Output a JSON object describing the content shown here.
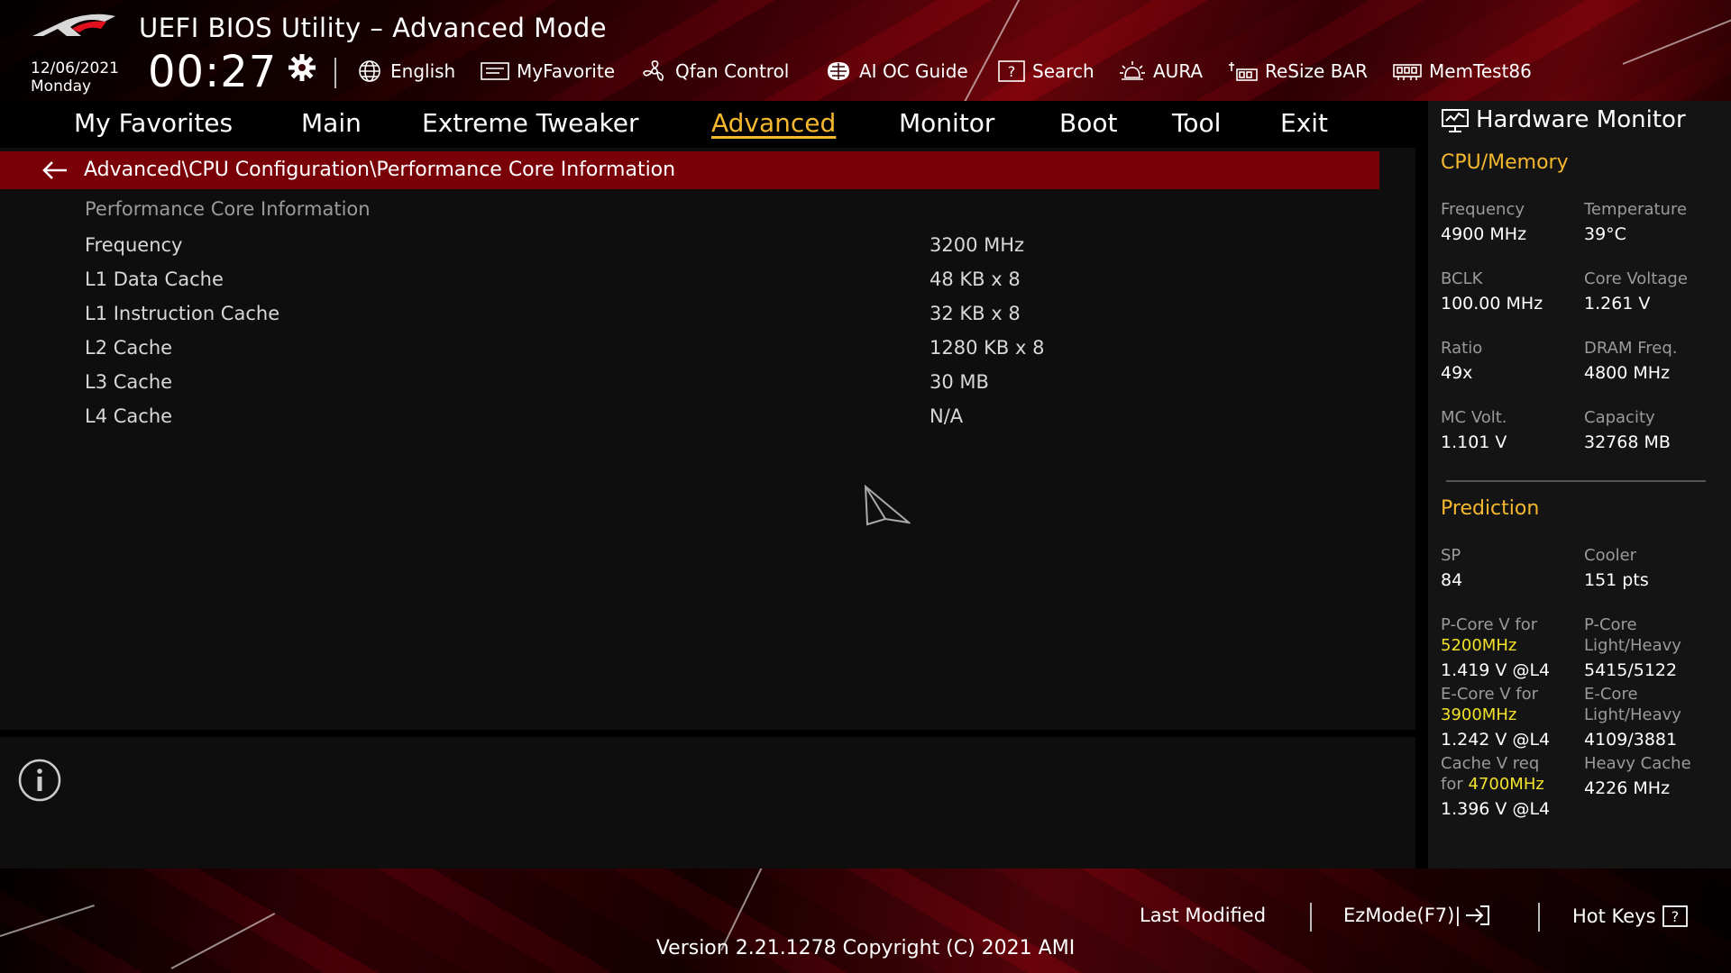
{
  "app": {
    "title": "UEFI BIOS Utility – Advanced Mode",
    "date": "12/06/2021",
    "day": "Monday",
    "time": "00:27"
  },
  "toolbar": [
    {
      "label": "English",
      "icon": "globe-icon"
    },
    {
      "label": "MyFavorite",
      "icon": "favorite-icon"
    },
    {
      "label": "Qfan Control",
      "icon": "fan-icon"
    },
    {
      "label": "AI OC Guide",
      "icon": "ai-oc-icon"
    },
    {
      "label": "Search",
      "icon": "search-icon"
    },
    {
      "label": "AURA",
      "icon": "aura-icon"
    },
    {
      "label": "ReSize BAR",
      "icon": "resize-bar-icon"
    },
    {
      "label": "MemTest86",
      "icon": "memtest-icon"
    }
  ],
  "nav": {
    "tabs": [
      "My Favorites",
      "Main",
      "Extreme Tweaker",
      "Advanced",
      "Monitor",
      "Boot",
      "Tool",
      "Exit"
    ],
    "active": "Advanced"
  },
  "breadcrumb": "Advanced\\CPU Configuration\\Performance Core Information",
  "section_title": "Performance Core Information",
  "rows": [
    {
      "label": "Frequency",
      "value": "3200 MHz"
    },
    {
      "label": "L1 Data Cache",
      "value": "48 KB x 8"
    },
    {
      "label": "L1 Instruction Cache",
      "value": "32 KB x 8"
    },
    {
      "label": "L2 Cache",
      "value": "1280 KB x 8"
    },
    {
      "label": "L3 Cache",
      "value": "30 MB"
    },
    {
      "label": "L4 Cache",
      "value": "N/A"
    }
  ],
  "hardware_monitor": {
    "title": "Hardware Monitor",
    "cpu_memory": {
      "heading": "CPU/Memory",
      "items": [
        {
          "label": "Frequency",
          "value": "4900 MHz"
        },
        {
          "label": "Temperature",
          "value": "39°C"
        },
        {
          "label": "BCLK",
          "value": "100.00 MHz"
        },
        {
          "label": "Core Voltage",
          "value": "1.261 V"
        },
        {
          "label": "Ratio",
          "value": "49x"
        },
        {
          "label": "DRAM Freq.",
          "value": "4800 MHz"
        },
        {
          "label": "MC Volt.",
          "value": "1.101 V"
        },
        {
          "label": "Capacity",
          "value": "32768 MB"
        }
      ]
    },
    "prediction": {
      "heading": "Prediction",
      "sp_label": "SP",
      "sp_value": "84",
      "cooler_label": "Cooler",
      "cooler_value": "151 pts",
      "pcore_v_label": "P-Core V for",
      "pcore_v_freq": "5200MHz",
      "pcore_v_value": "1.419 V @L4",
      "pcore_lh_label_1": "P-Core",
      "pcore_lh_label_2": "Light/Heavy",
      "pcore_lh_value": "5415/5122",
      "ecore_v_label": "E-Core V for",
      "ecore_v_freq": "3900MHz",
      "ecore_v_value": "1.242 V @L4",
      "ecore_lh_label_1": "E-Core",
      "ecore_lh_label_2": "Light/Heavy",
      "ecore_lh_value": "4109/3881",
      "cache_v_label_1": "Cache V req",
      "cache_v_label_2": "for",
      "cache_v_freq": "4700MHz",
      "cache_v_value": "1.396 V @L4",
      "heavy_cache_label": "Heavy Cache",
      "heavy_cache_value": "4226 MHz"
    }
  },
  "footer": {
    "last_modified": "Last Modified",
    "ezmode": "EzMode(F7)|",
    "hotkeys": "Hot Keys",
    "version": "Version 2.21.1278 Copyright (C) 2021 AMI"
  },
  "colors": {
    "accent": "#f5b82e",
    "highlight": "#f2e22a",
    "crumb_bar": "#7a0008"
  }
}
